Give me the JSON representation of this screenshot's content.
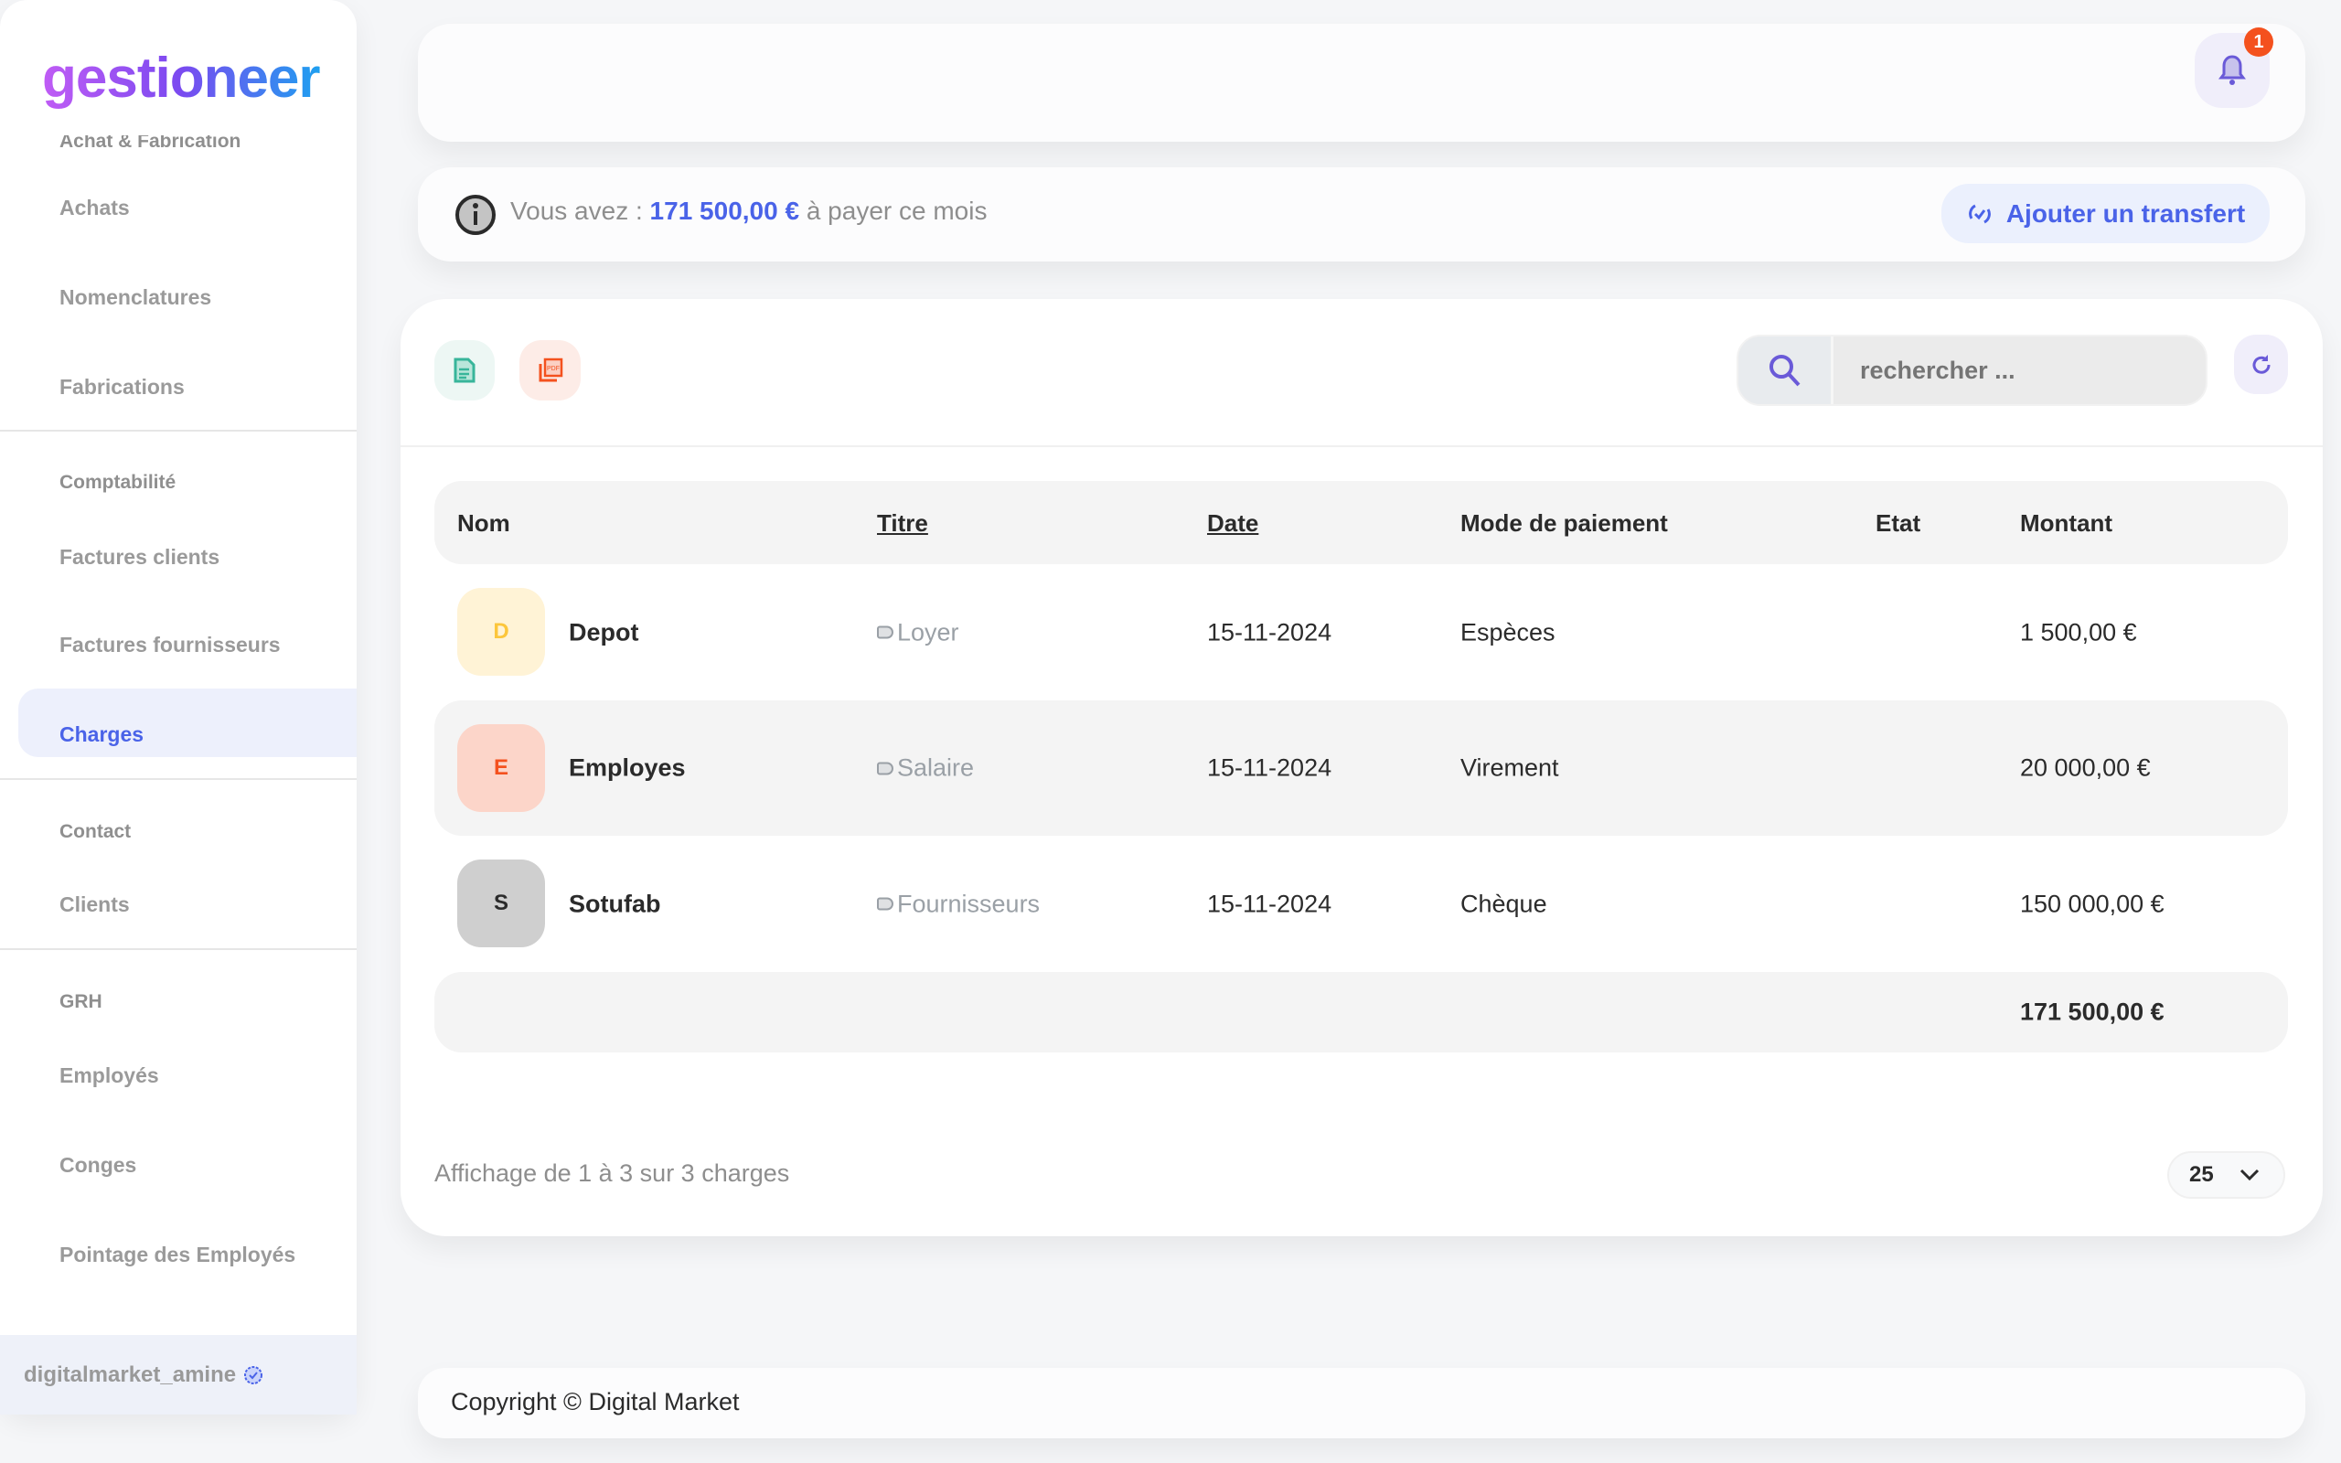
{
  "app": {
    "logo": "gestioneer"
  },
  "sidebar": {
    "sections": [
      {
        "title": "Achat & Fabrication",
        "items": [
          "Achats",
          "Nomenclatures",
          "Fabrications"
        ]
      },
      {
        "title": "Comptabilité",
        "items": [
          "Factures clients",
          "Factures fournisseurs",
          "Charges"
        ]
      },
      {
        "title": "Contact",
        "items": [
          "Clients"
        ]
      },
      {
        "title": "GRH",
        "items": [
          "Employés",
          "Conges",
          "Pointage des Employés"
        ]
      }
    ],
    "active_item": "Charges",
    "user": "digitalmarket_amine"
  },
  "header": {
    "notification_count": "1"
  },
  "info": {
    "prefix": "Vous avez :",
    "amount": "171 500,00 €",
    "suffix": "à payer ce mois",
    "button": "Ajouter un transfert"
  },
  "toolbar": {
    "search_placeholder": "rechercher ..."
  },
  "table": {
    "columns": [
      "Nom",
      "Titre",
      "Date",
      "Mode de paiement",
      "Etat",
      "Montant"
    ],
    "rows": [
      {
        "initial": "D",
        "name": "Depot",
        "title": "Loyer",
        "date": "15-11-2024",
        "mode": "Espèces",
        "etat": "",
        "amount": "1 500,00 €"
      },
      {
        "initial": "E",
        "name": "Employes",
        "title": "Salaire",
        "date": "15-11-2024",
        "mode": "Virement",
        "etat": "",
        "amount": "20 000,00 €"
      },
      {
        "initial": "S",
        "name": "Sotufab",
        "title": "Fournisseurs",
        "date": "15-11-2024",
        "mode": "Chèque",
        "etat": "",
        "amount": "150 000,00 €"
      }
    ],
    "total": "171 500,00 €"
  },
  "footer": {
    "summary": "Affichage de 1 à 3 sur 3 charges",
    "page_size": "25"
  },
  "copyright": "Copyright © Digital Market",
  "colors": {
    "accent": "#4a63e8",
    "badge": "#f4511e",
    "avatar_d": "#fff3d6",
    "avatar_e": "#fcd5c9",
    "avatar_s": "#cfcfcf"
  }
}
